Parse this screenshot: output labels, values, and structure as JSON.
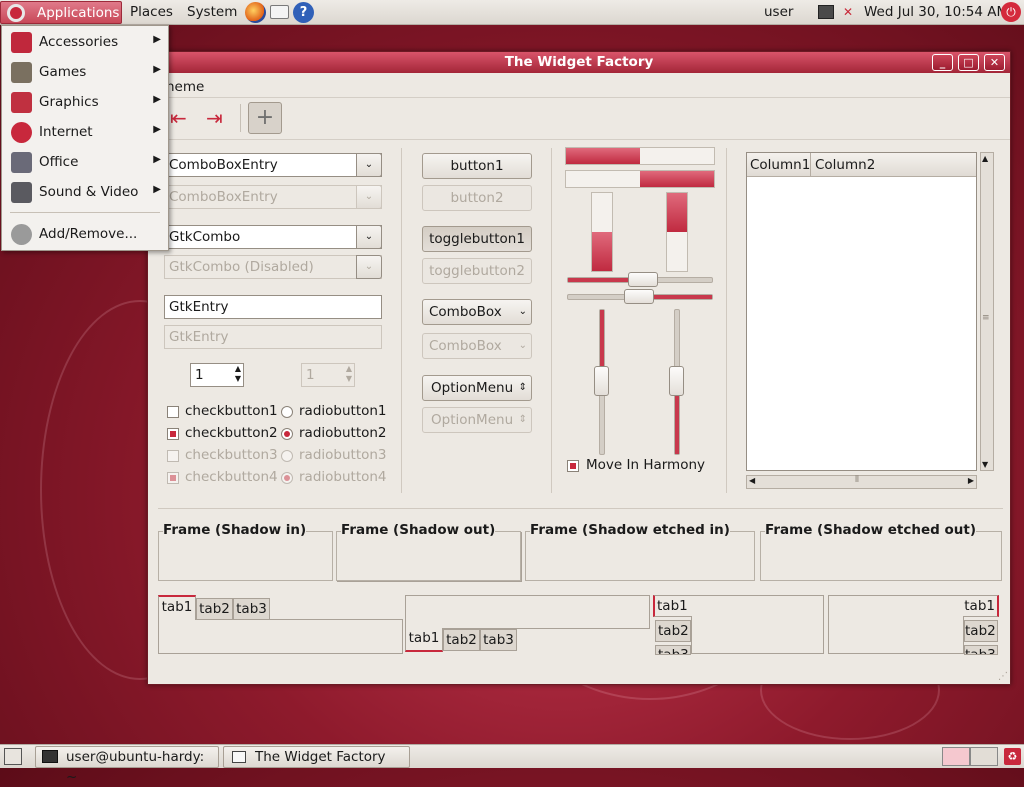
{
  "top_panel": {
    "applications": "Applications",
    "places": "Places",
    "system": "System",
    "user": "user",
    "clock": "Wed Jul 30, 10:54 AM"
  },
  "app_menu": {
    "items": [
      {
        "label": "Accessories",
        "icon": "accessories-icon",
        "color": "#c0283c"
      },
      {
        "label": "Games",
        "icon": "games-icon",
        "color": "#7a7060"
      },
      {
        "label": "Graphics",
        "icon": "graphics-icon",
        "color": "#c03040"
      },
      {
        "label": "Internet",
        "icon": "internet-icon",
        "color": "#c8283c"
      },
      {
        "label": "Office",
        "icon": "office-icon",
        "color": "#6a6a78"
      },
      {
        "label": "Sound & Video",
        "icon": "sound-video-icon",
        "color": "#5a5a60"
      }
    ],
    "add_remove": "Add/Remove..."
  },
  "window": {
    "title": "The Widget Factory",
    "menu": "heme",
    "buttons": {
      "minimize": "_",
      "maximize": "□",
      "close": "✕"
    }
  },
  "col1": {
    "combo_entry": "ComboBoxEntry",
    "combo_entry_disabled": "ComboBoxEntry",
    "gtk_combo": "GtkCombo",
    "gtk_combo_disabled": "GtkCombo (Disabled)",
    "entry": "GtkEntry",
    "entry_disabled": "GtkEntry",
    "spin": "1",
    "spin_disabled": "1",
    "checks": [
      "checkbutton1",
      "checkbutton2",
      "checkbutton3",
      "checkbutton4"
    ],
    "radios": [
      "radiobutton1",
      "radiobutton2",
      "radiobutton3",
      "radiobutton4"
    ]
  },
  "col2": {
    "button1": "button1",
    "button2": "button2",
    "toggle1": "togglebutton1",
    "toggle2": "togglebutton2",
    "combobox": "ComboBox",
    "combobox_disabled": "ComboBox",
    "option": "OptionMenu",
    "option_disabled": "OptionMenu"
  },
  "col3": {
    "progress_h1": 0.5,
    "progress_h2": 0.5,
    "progress_v1": 0.5,
    "progress_v2": 0.5,
    "move_in_harmony": "Move In Harmony"
  },
  "tree": {
    "col1": "Column1",
    "col2": "Column2"
  },
  "frames": [
    "Frame (Shadow in)",
    "Frame (Shadow out)",
    "Frame (Shadow etched in)",
    "Frame (Shadow etched out)"
  ],
  "tabs": {
    "t1": "tab1",
    "t2": "tab2",
    "t3": "tab3"
  },
  "bottom_panel": {
    "terminal": "user@ubuntu-hardy: ~",
    "widget_factory": "The Widget Factory"
  }
}
